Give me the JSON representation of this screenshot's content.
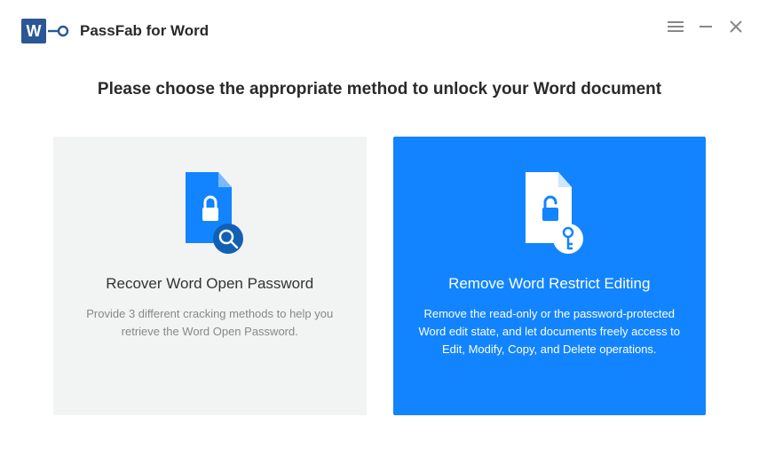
{
  "app": {
    "title": "PassFab for Word"
  },
  "heading": "Please choose the appropriate method to unlock your Word document",
  "cards": {
    "recover": {
      "title": "Recover Word Open Password",
      "desc": "Provide 3 different cracking methods to help you retrieve the Word Open Password."
    },
    "remove": {
      "title": "Remove Word Restrict Editing",
      "desc": "Remove the read-only or the password-protected Word edit state, and let documents freely access to Edit, Modify, Copy, and Delete operations."
    }
  },
  "colors": {
    "accent": "#1284ff",
    "wordBlue": "#2b5797",
    "panelGray": "#f2f3f3"
  }
}
